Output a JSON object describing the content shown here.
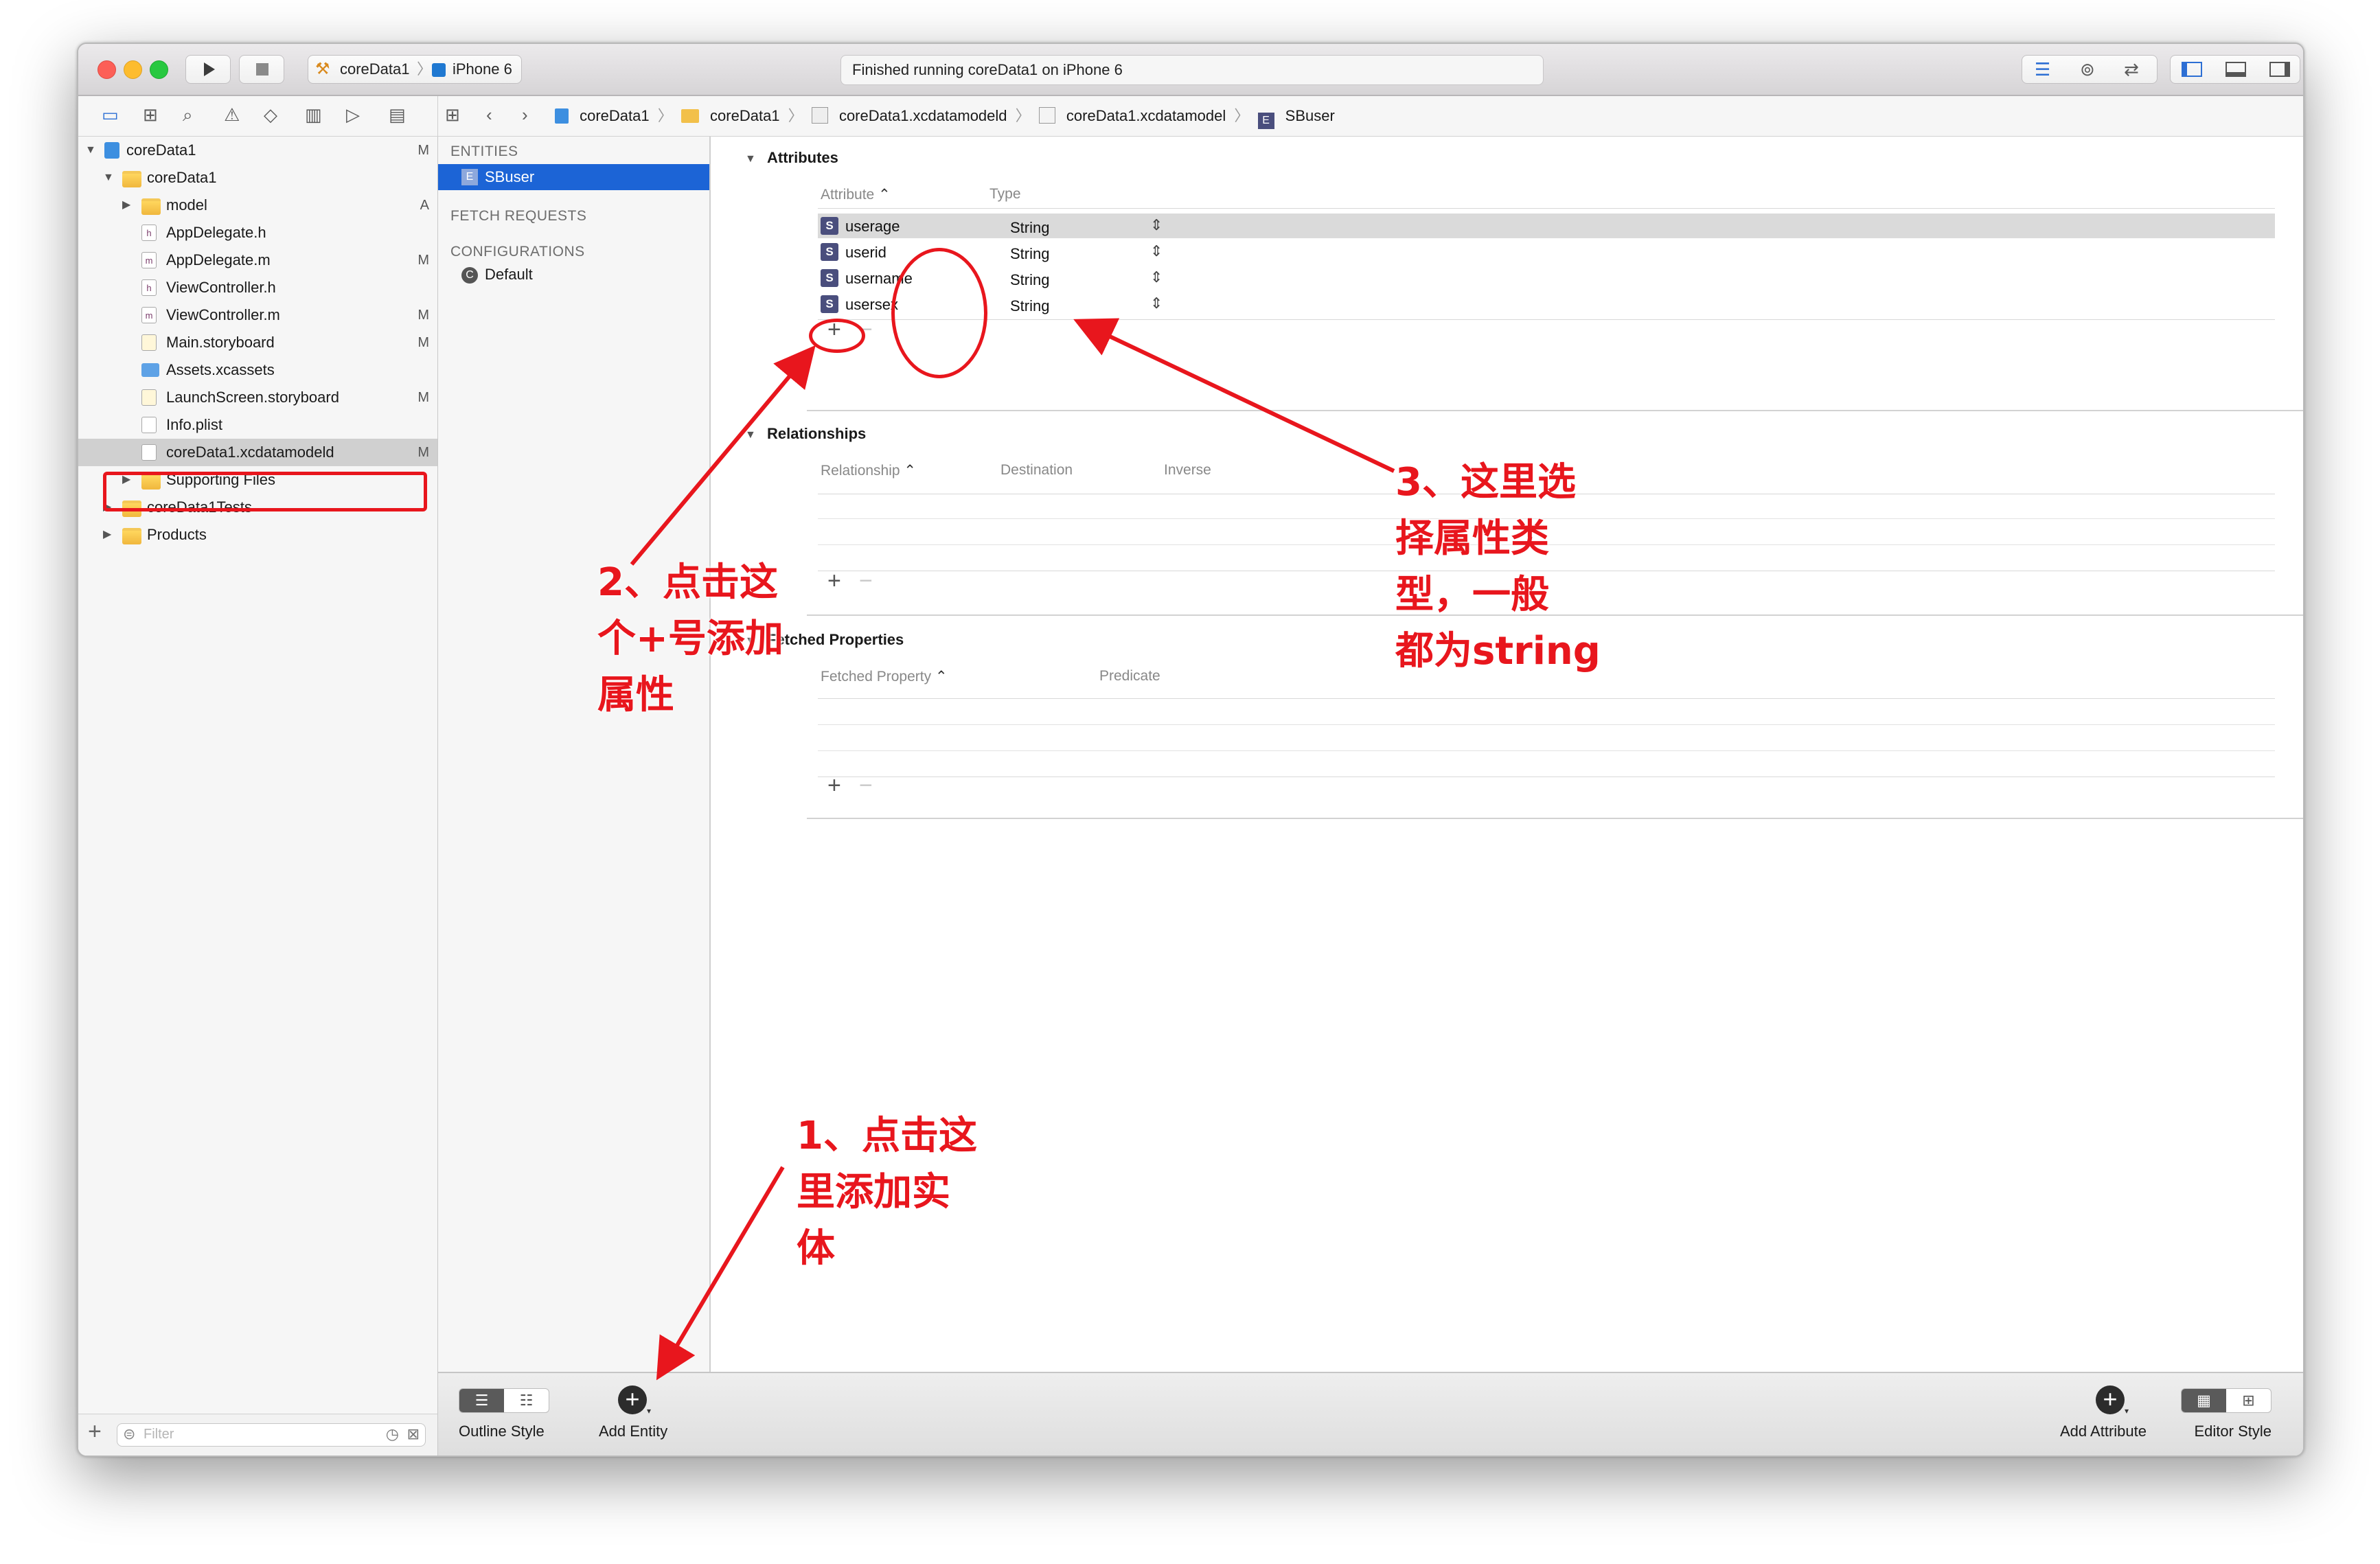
{
  "toolbar": {
    "scheme": "coreData1",
    "device": "iPhone 6",
    "activity": "Finished running coreData1 on iPhone 6"
  },
  "jumpbar": {
    "crumbs": [
      "coreData1",
      "coreData1",
      "coreData1.xcdatamodeld",
      "coreData1.xcdatamodel",
      "SBuser"
    ]
  },
  "navigator": {
    "items": [
      {
        "label": "coreData1",
        "flag": "M"
      },
      {
        "label": "coreData1",
        "flag": ""
      },
      {
        "label": "model",
        "flag": "A"
      },
      {
        "label": "AppDelegate.h",
        "flag": ""
      },
      {
        "label": "AppDelegate.m",
        "flag": "M"
      },
      {
        "label": "ViewController.h",
        "flag": ""
      },
      {
        "label": "ViewController.m",
        "flag": "M"
      },
      {
        "label": "Main.storyboard",
        "flag": "M"
      },
      {
        "label": "Assets.xcassets",
        "flag": ""
      },
      {
        "label": "LaunchScreen.storyboard",
        "flag": "M"
      },
      {
        "label": "Info.plist",
        "flag": ""
      },
      {
        "label": "coreData1.xcdatamodeld",
        "flag": "M"
      },
      {
        "label": "Supporting Files",
        "flag": ""
      },
      {
        "label": "coreData1Tests",
        "flag": ""
      },
      {
        "label": "Products",
        "flag": ""
      }
    ],
    "filter_placeholder": "Filter"
  },
  "entities": {
    "entities_header": "ENTITIES",
    "entity": "SBuser",
    "fetch_header": "FETCH REQUESTS",
    "config_header": "CONFIGURATIONS",
    "config_default": "Default"
  },
  "attributes": {
    "title": "Attributes",
    "col_attribute": "Attribute",
    "col_type": "Type",
    "rows": [
      {
        "name": "userage",
        "type": "String"
      },
      {
        "name": "userid",
        "type": "String"
      },
      {
        "name": "username",
        "type": "String"
      },
      {
        "name": "usersex",
        "type": "String"
      }
    ]
  },
  "relationships": {
    "title": "Relationships",
    "col_relationship": "Relationship",
    "col_destination": "Destination",
    "col_inverse": "Inverse"
  },
  "fetched": {
    "title": "Fetched Properties",
    "col_property": "Fetched Property",
    "col_predicate": "Predicate"
  },
  "bottombar": {
    "outline_style": "Outline Style",
    "add_entity": "Add Entity",
    "add_attribute": "Add Attribute",
    "editor_style": "Editor Style"
  },
  "annotations": {
    "step1": [
      "1、点击这",
      "里添加实",
      "体"
    ],
    "step2": [
      "2、点击这",
      "个+号添加",
      "属性"
    ],
    "step3": [
      "3、这里选",
      "择属性类",
      "型，一般",
      "都为string"
    ]
  },
  "colors": {
    "annotation_red": "#e8161d",
    "selection_blue": "#1c64d6"
  }
}
